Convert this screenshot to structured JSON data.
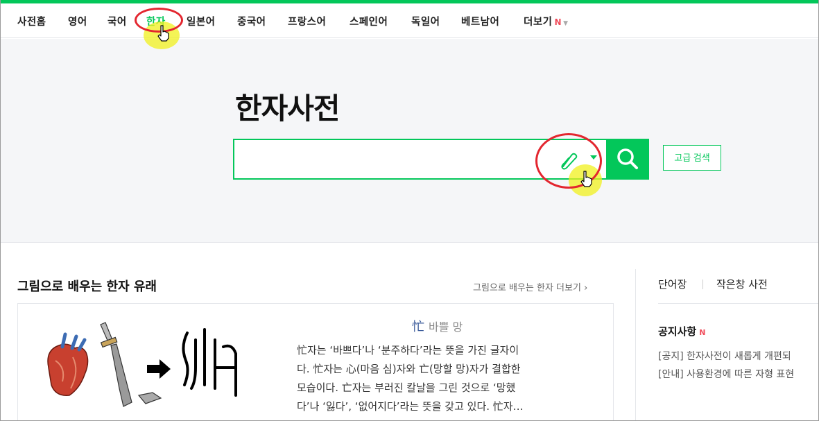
{
  "nav": {
    "items": [
      {
        "label": "사전홈"
      },
      {
        "label": "영어"
      },
      {
        "label": "국어"
      },
      {
        "label": "한자"
      },
      {
        "label": "일본어"
      },
      {
        "label": "중국어"
      },
      {
        "label": "프랑스어"
      },
      {
        "label": "스페인어"
      },
      {
        "label": "독일어"
      },
      {
        "label": "베트남어"
      },
      {
        "label": "더보기"
      }
    ],
    "more_badge": "N",
    "active_index": 3
  },
  "hero": {
    "title": "한자사전",
    "search_value": "",
    "advanced_search_label": "고급 검색"
  },
  "section": {
    "title": "그림으로 배우는 한자 유래",
    "more_label": "그림으로 배우는 한자 더보기",
    "more_chevron": "›",
    "hanja": "忙",
    "hanja_meaning": "바쁠 망",
    "desc_line1": "忙자는 ‘바쁘다’나 ‘분주하다’라는 뜻을 가진 글자이",
    "desc_line2": "다. 忙자는 心(마음 심)자와 亡(망할 망)자가 결합한",
    "desc_line3": "모습이다. 亡자는 부러진 칼날을 그린 것으로 ‘망했",
    "desc_line4": "다’나 ‘잃다’, ‘없어지다’라는 뜻을 갖고 있다. 忙자…"
  },
  "sidebar": {
    "tab1": "단어장",
    "tab2": "작은창 사전",
    "notice_title": "공지사항",
    "notice_badge": "N",
    "notices": [
      "[공지] 한자사전이 새롭게 개편되",
      "[안내] 사용환경에 따른 자형 표현"
    ]
  },
  "colors": {
    "brand": "#03c75a",
    "highlight_ring": "#e3262f",
    "new_badge": "#f04b5a"
  }
}
